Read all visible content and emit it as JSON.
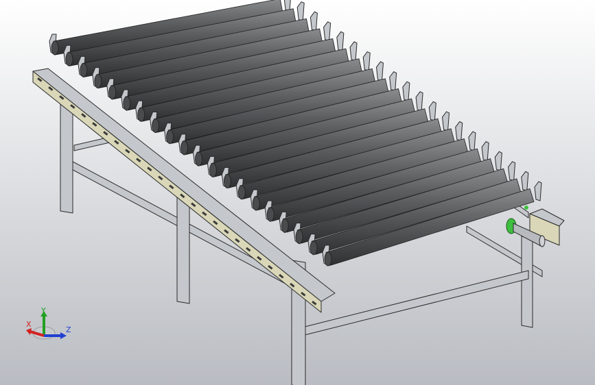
{
  "viewport": {
    "background_top": "#ffffff",
    "background_bottom": "#b9bcc2",
    "model": {
      "roller_count": 20,
      "roller_color": "#5b5d5f",
      "roller_highlight": "#8a8c8e",
      "frame_color": "#c4c7cc",
      "frame_edge": "#2a2a2a",
      "rail_face_color": "#d9d7b8",
      "accent_green": "#3fbf3f"
    }
  },
  "triad": {
    "x_label": "X",
    "y_label": "Y",
    "z_label": "Z",
    "x_color": "#d42020",
    "y_color": "#22a022",
    "z_color": "#2040d0"
  }
}
